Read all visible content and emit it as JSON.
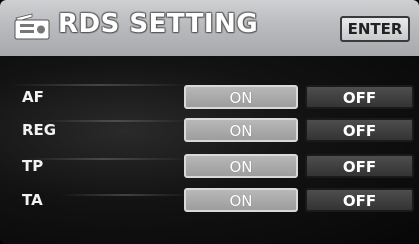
{
  "header": {
    "title": "RDS SETTING",
    "icon": "tuner-icon",
    "enter_label": "ENTER"
  },
  "rows": [
    {
      "label": "AF",
      "on_label": "ON",
      "off_label": "OFF",
      "selected": "ON"
    },
    {
      "label": "REG",
      "on_label": "ON",
      "off_label": "OFF",
      "selected": "ON"
    },
    {
      "label": "TP",
      "on_label": "ON",
      "off_label": "OFF",
      "selected": "ON"
    },
    {
      "label": "TA",
      "on_label": "ON",
      "off_label": "OFF",
      "selected": "ON"
    }
  ],
  "colors": {
    "header_bg": "#b9bbbe",
    "body_bg": "#0a0a0a",
    "on_button": "#a8a8a8",
    "off_button": "#404040",
    "text": "#ffffff"
  }
}
